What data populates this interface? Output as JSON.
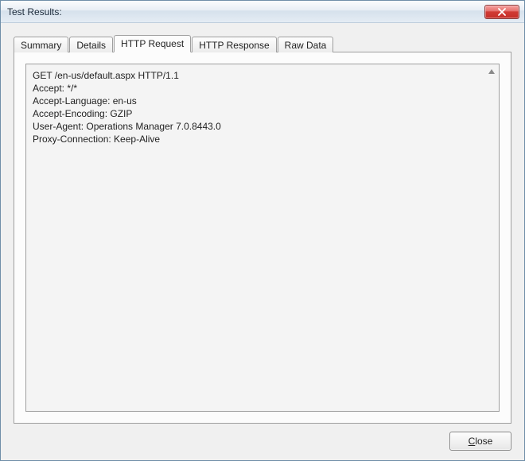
{
  "window": {
    "title": "Test Results:"
  },
  "tabs": [
    {
      "label": "Summary",
      "active": false
    },
    {
      "label": "Details",
      "active": false
    },
    {
      "label": "HTTP Request",
      "active": true
    },
    {
      "label": "HTTP Response",
      "active": false
    },
    {
      "label": "Raw Data",
      "active": false
    }
  ],
  "http_request": {
    "lines": [
      "GET /en-us/default.aspx HTTP/1.1",
      "Accept: */*",
      "Accept-Language: en-us",
      "Accept-Encoding: GZIP",
      "User-Agent: Operations Manager 7.0.8443.0",
      "Proxy-Connection: Keep-Alive"
    ]
  },
  "buttons": {
    "close": "Close"
  }
}
